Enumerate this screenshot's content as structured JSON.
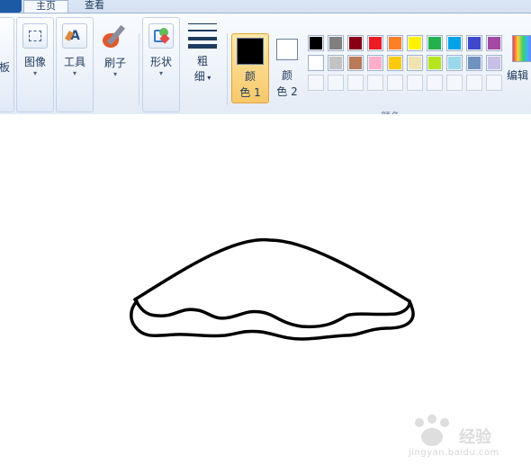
{
  "tabs": {
    "home": "主页",
    "view": "查看"
  },
  "groups": {
    "clipboard_partial": "板",
    "image": "图像",
    "tools": "工具",
    "brushes": "刷子",
    "shapes": "形状",
    "size_line1": "粗",
    "size_line2": "细",
    "color1_line1": "颜",
    "color1_line2": "色 1",
    "color2_line1": "颜",
    "color2_line2": "色 2",
    "colors_group": "颜色",
    "edit_colors": "编辑"
  },
  "colors": {
    "color1": "#000000",
    "color2": "#ffffff",
    "palette_row1": [
      "#000000",
      "#7f7f7f",
      "#880015",
      "#ed1c24",
      "#ff7f27",
      "#fff200",
      "#22b14c",
      "#00a2e8",
      "#3f48cc",
      "#a349a4"
    ],
    "palette_row2": [
      "#ffffff",
      "#c3c3c3",
      "#b97a57",
      "#ffaec9",
      "#ffc90e",
      "#efe4b0",
      "#b5e61d",
      "#99d9ea",
      "#7092be",
      "#c8bfe7"
    ],
    "palette_row3": [
      "",
      "",
      "",
      "",
      "",
      "",
      "",
      "",
      "",
      ""
    ]
  },
  "watermark": {
    "text": "经验",
    "url": "jingyan.baidu.com"
  }
}
